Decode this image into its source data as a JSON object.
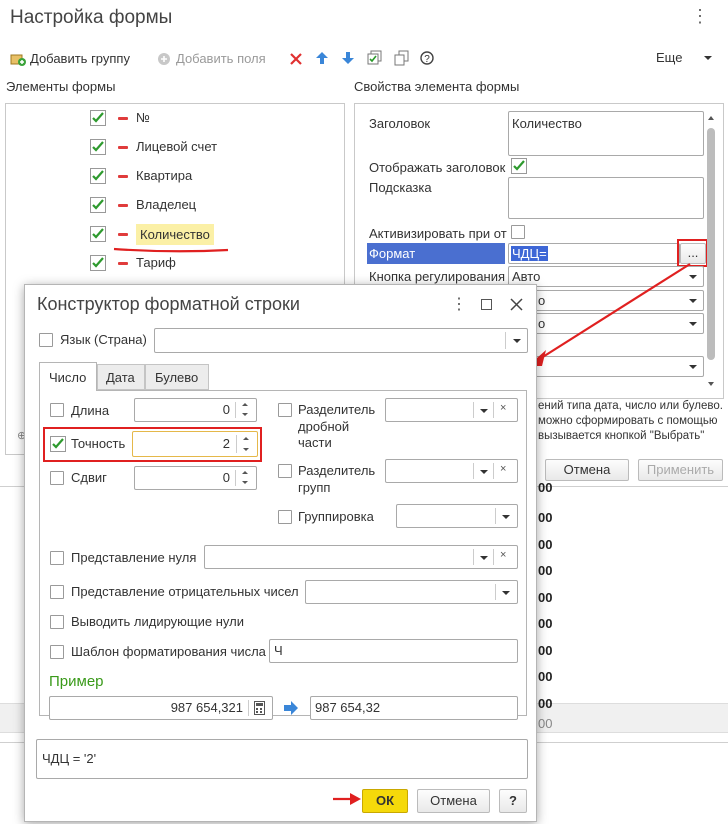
{
  "background_window": {
    "title": "Настройка формы",
    "toolbar": {
      "add_group": "Добавить группу",
      "add_fields": "Добавить поля",
      "more": "Еще",
      "icons": [
        "delete-icon",
        "arrow-up-icon",
        "arrow-down-icon",
        "check-all-icon",
        "copy-icon",
        "help-icon"
      ]
    },
    "left_panel_title": "Элементы формы",
    "right_panel_title": "Свойства элемента формы",
    "tree_items": [
      {
        "label": "№",
        "checked": true
      },
      {
        "label": "Лицевой счет",
        "checked": true
      },
      {
        "label": "Квартира",
        "checked": true
      },
      {
        "label": "Владелец",
        "checked": true
      },
      {
        "label": "Количество",
        "checked": true,
        "selected": true
      },
      {
        "label": "Тариф",
        "checked": true
      }
    ],
    "properties": {
      "header_label": "Заголовок",
      "header_value": "Количество",
      "show_header_label": "Отображать заголовок",
      "show_header_checked": true,
      "hint_label": "Подсказка",
      "activate_label": "Активизировать при отк",
      "format_label": "Формат",
      "format_value": "ЧДЦ=",
      "format_button": "...",
      "adjust_button_label": "Кнопка регулирования",
      "adjust_button_value": "Авто",
      "partial_value_1": "о",
      "partial_value_2": "о"
    },
    "help_text_lines": [
      "ений типа дата, число или булево.",
      "можно сформировать с помощью",
      "вызывается кнопкой \"Выбрать\""
    ],
    "cancel_button": "Отмена",
    "apply_button": "Применить",
    "partial_numbers": [
      "00",
      "00",
      "00",
      "00",
      "00",
      "00",
      "00",
      "00",
      "00",
      "00"
    ]
  },
  "dialog": {
    "title": "Конструктор форматной строки",
    "language_label": "Язык (Страна)",
    "tabs": [
      {
        "label": "Число",
        "active": true
      },
      {
        "label": "Дата",
        "active": false
      },
      {
        "label": "Булево",
        "active": false
      }
    ],
    "length": {
      "label": "Длина",
      "value": "0",
      "checked": false
    },
    "precision": {
      "label": "Точность",
      "value": "2",
      "checked": true
    },
    "shift": {
      "label": "Сдвиг",
      "value": "0",
      "checked": false
    },
    "fraction_separator": {
      "label_lines": [
        "Разделитель",
        "дробной",
        "части"
      ],
      "checked": false
    },
    "group_separator": {
      "label_lines": [
        "Разделитель",
        "групп"
      ],
      "checked": false
    },
    "grouping": {
      "label": "Группировка",
      "checked": false
    },
    "zero_repr": {
      "label": "Представление нуля",
      "checked": false
    },
    "negative_repr": {
      "label": "Представление отрицательных чисел",
      "checked": false
    },
    "leading_zeros": {
      "label": "Выводить лидирующие нули",
      "checked": false
    },
    "template": {
      "label": "Шаблон форматирования числа",
      "value": "Ч",
      "checked": false
    },
    "example_title": "Пример",
    "example_input": "987 654,321",
    "example_output": "987 654,32",
    "format_string": "ЧДЦ = '2'",
    "ok_button": "ОК",
    "cancel_button": "Отмена",
    "help_button": "?",
    "colors": {
      "example_title": "#3a9a1a",
      "highlight": "#e02020",
      "ok": "#f5d90a",
      "format_selected": "#4a6fd0"
    }
  }
}
